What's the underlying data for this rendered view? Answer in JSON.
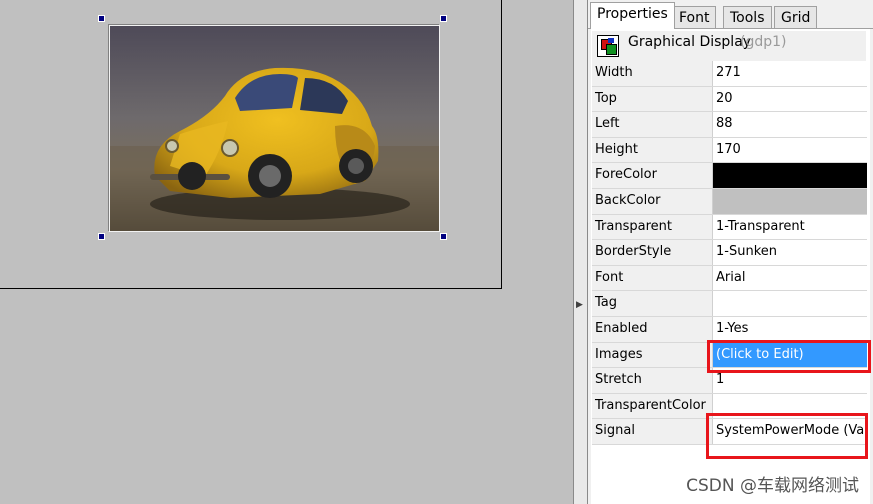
{
  "tabs": [
    {
      "label": "Properties",
      "active": true
    },
    {
      "label": "Font",
      "active": false
    },
    {
      "label": "Tools",
      "active": false
    },
    {
      "label": "Grid",
      "active": false
    }
  ],
  "object": {
    "name": "Graphical Display",
    "id": "(gdp1)",
    "icon": "graphical-display-icon"
  },
  "properties": [
    {
      "name": "Width",
      "value": "271"
    },
    {
      "name": "Top",
      "value": "20"
    },
    {
      "name": "Left",
      "value": "88"
    },
    {
      "name": "Height",
      "value": "170"
    },
    {
      "name": "ForeColor",
      "value": "",
      "swatch": "#000000"
    },
    {
      "name": "BackColor",
      "value": "",
      "swatch": "#c0c0c0"
    },
    {
      "name": "Transparent",
      "value": "1-Transparent"
    },
    {
      "name": "BorderStyle",
      "value": "1-Sunken"
    },
    {
      "name": "Font",
      "value": "Arial"
    },
    {
      "name": "Tag",
      "value": ""
    },
    {
      "name": "Enabled",
      "value": "1-Yes"
    },
    {
      "name": "Images",
      "value": "(Click to Edit)",
      "selected": true
    },
    {
      "name": "Stretch",
      "value": "1"
    },
    {
      "name": "TransparentColor",
      "value": ""
    },
    {
      "name": "Signal",
      "value": "SystemPowerMode (Valu"
    }
  ],
  "colors": {
    "selection": "#3399ff",
    "highlight": "#e8151b",
    "handles": "#000080"
  },
  "watermark": "CSDN @车载网络测试"
}
